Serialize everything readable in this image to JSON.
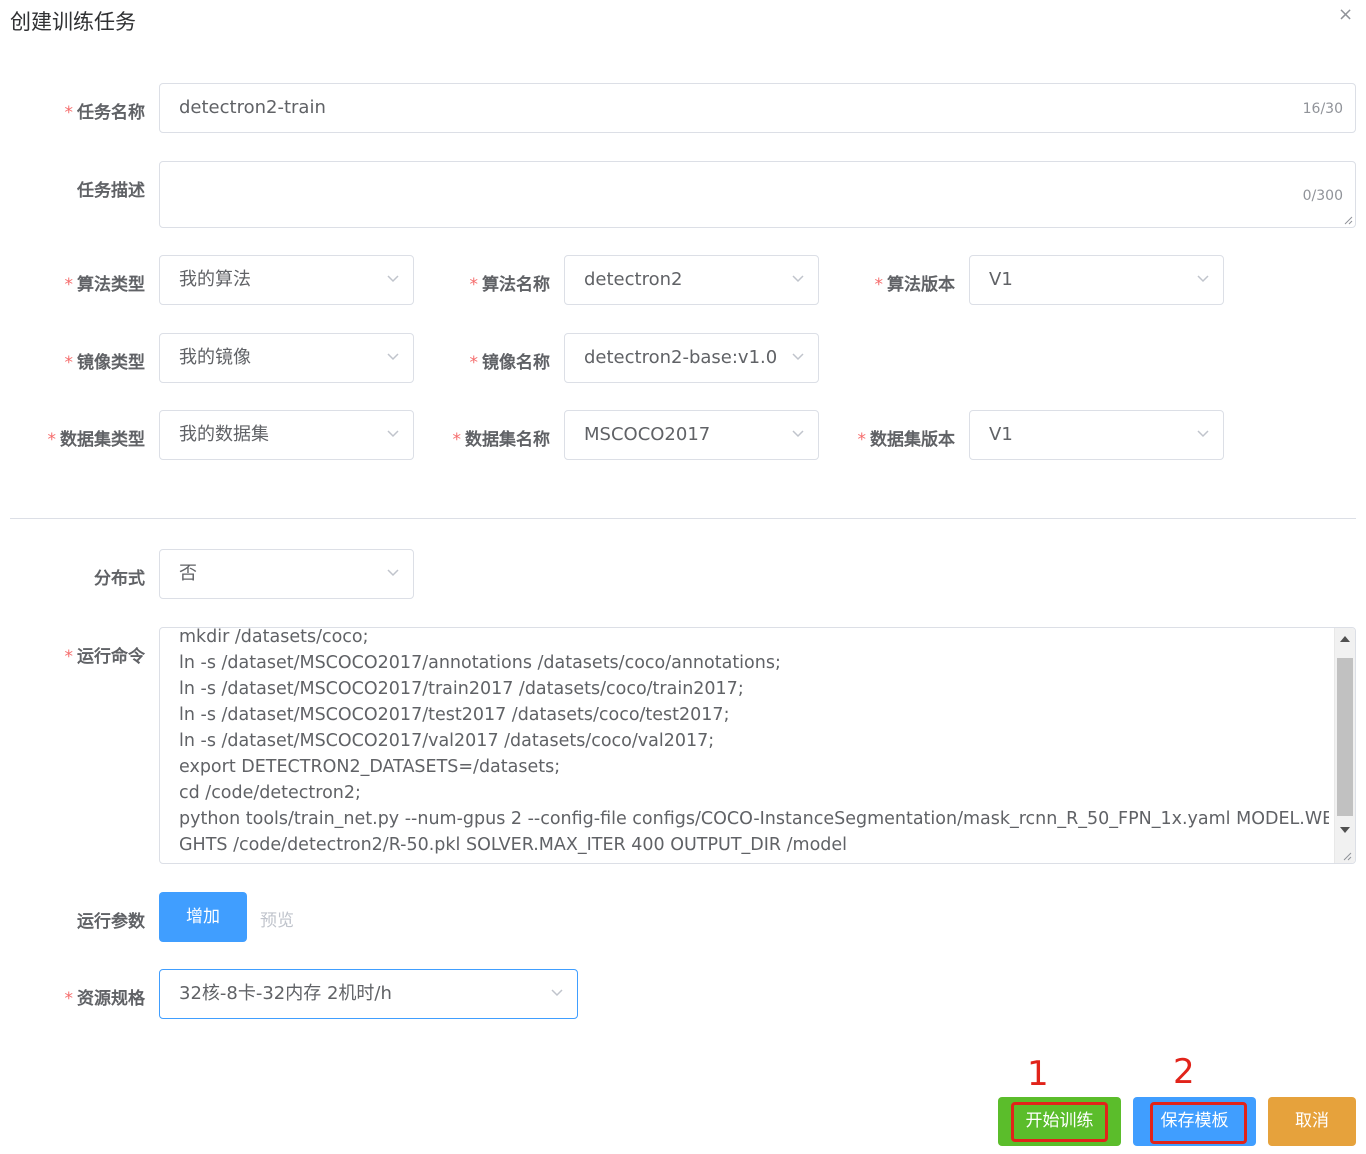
{
  "dialog": {
    "title": "创建训练任务",
    "close_icon": "×"
  },
  "form": {
    "required_mark": "*",
    "task_name": {
      "label": "任务名称",
      "value": "detectron2-train",
      "counter": "16/30"
    },
    "task_desc": {
      "label": "任务描述",
      "value": "",
      "counter": "0/300"
    },
    "algo_type": {
      "label": "算法类型",
      "value": "我的算法"
    },
    "algo_name": {
      "label": "算法名称",
      "value": "detectron2"
    },
    "algo_version": {
      "label": "算法版本",
      "value": "V1"
    },
    "image_type": {
      "label": "镜像类型",
      "value": "我的镜像"
    },
    "image_name": {
      "label": "镜像名称",
      "value": "detectron2-base:v1.0"
    },
    "dataset_type": {
      "label": "数据集类型",
      "value": "我的数据集"
    },
    "dataset_name": {
      "label": "数据集名称",
      "value": "MSCOCO2017"
    },
    "dataset_version": {
      "label": "数据集版本",
      "value": "V1"
    },
    "distributed": {
      "label": "分布式",
      "value": "否"
    },
    "command": {
      "label": "运行命令",
      "lines": [
        "mkdir /datasets/coco;",
        "ln -s /dataset/MSCOCO2017/annotations /datasets/coco/annotations;",
        "ln -s /dataset/MSCOCO2017/train2017 /datasets/coco/train2017;",
        "ln -s /dataset/MSCOCO2017/test2017 /datasets/coco/test2017;",
        "ln -s /dataset/MSCOCO2017/val2017 /datasets/coco/val2017;",
        "export DETECTRON2_DATASETS=/datasets;",
        "cd /code/detectron2;",
        "python tools/train_net.py --num-gpus 2 --config-file configs/COCO-InstanceSegmentation/mask_rcnn_R_50_FPN_1x.yaml MODEL.WEI",
        "GHTS /code/detectron2/R-50.pkl  SOLVER.MAX_ITER 400  OUTPUT_DIR /model"
      ]
    },
    "run_params": {
      "label": "运行参数",
      "add_button": "增加",
      "preview_link": "预览"
    },
    "resource": {
      "label": "资源规格",
      "value": "32核-8卡-32内存 2机时/h"
    }
  },
  "footer": {
    "start_button": "开始训练",
    "save_template_button": "保存模板",
    "cancel_button": "取消",
    "annotation_1": "1",
    "annotation_2": "2"
  },
  "colors": {
    "required": "#f56c6c",
    "primary": "#409eff",
    "success": "#5bbd2b",
    "warning": "#e6a23c",
    "annotation": "#e1231a"
  }
}
